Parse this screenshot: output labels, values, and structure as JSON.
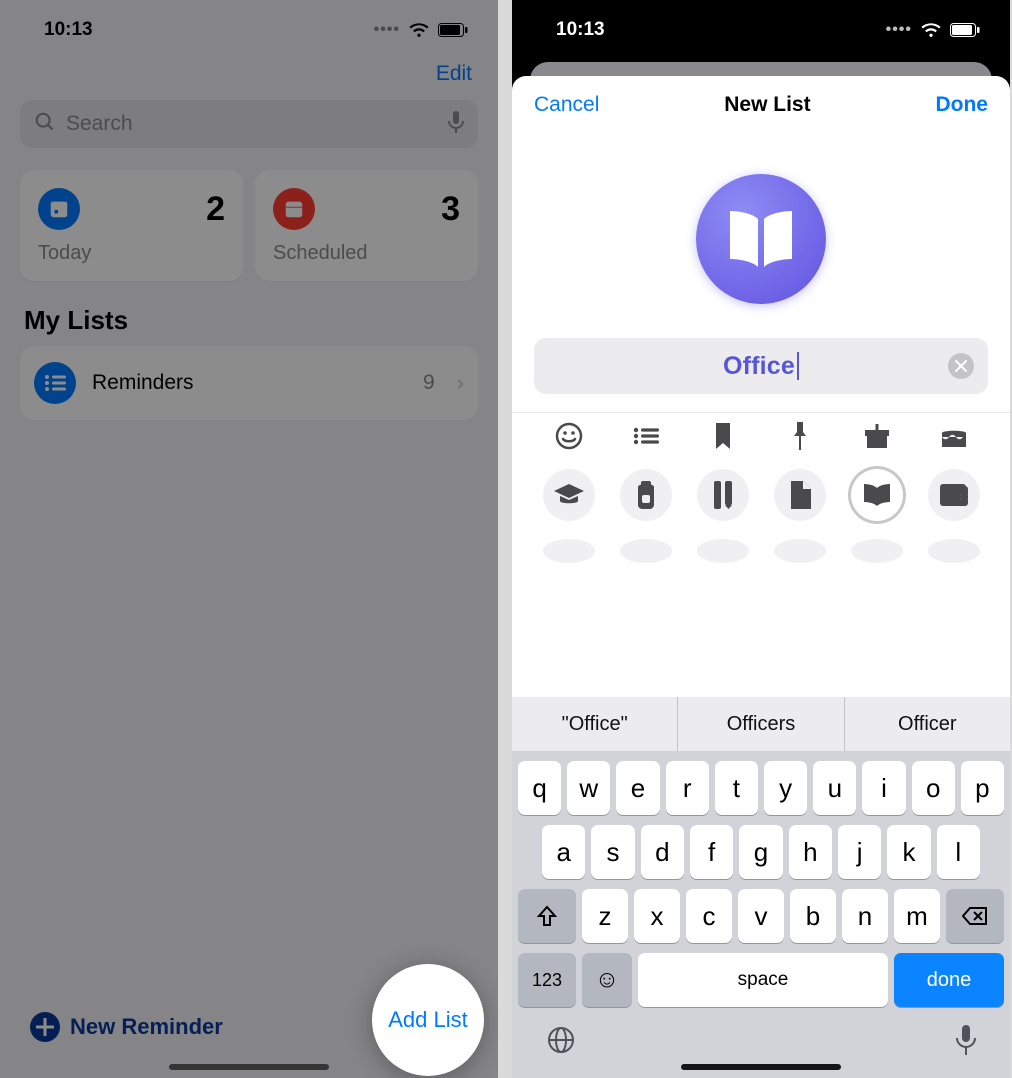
{
  "left": {
    "status": {
      "time": "10:13"
    },
    "edit_label": "Edit",
    "search_placeholder": "Search",
    "cards": {
      "today": {
        "label": "Today",
        "count": "2"
      },
      "scheduled": {
        "label": "Scheduled",
        "count": "3"
      }
    },
    "section_title": "My Lists",
    "list": {
      "name": "Reminders",
      "count": "9"
    },
    "new_reminder_label": "New Reminder",
    "add_list_label": "Add List"
  },
  "right": {
    "status": {
      "time": "10:13"
    },
    "sheet": {
      "cancel_label": "Cancel",
      "title": "New List",
      "done_label": "Done",
      "name_value": "Office"
    },
    "keyboard": {
      "suggestions": [
        "\"Office\"",
        "Officers",
        "Officer"
      ],
      "row1": [
        "q",
        "w",
        "e",
        "r",
        "t",
        "y",
        "u",
        "i",
        "o",
        "p"
      ],
      "row2": [
        "a",
        "s",
        "d",
        "f",
        "g",
        "h",
        "j",
        "k",
        "l"
      ],
      "row3": [
        "z",
        "x",
        "c",
        "v",
        "b",
        "n",
        "m"
      ],
      "numbers_label": "123",
      "space_label": "space",
      "done_label": "done"
    }
  }
}
